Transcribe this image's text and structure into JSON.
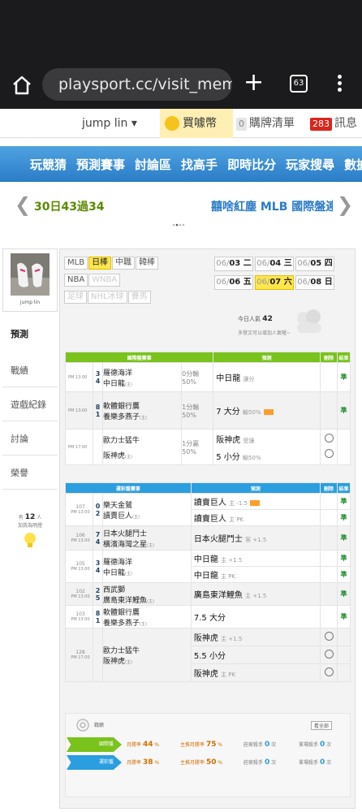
{
  "browser": {
    "url": "playsport.cc/visit_memb",
    "tab_count": "63"
  },
  "userbar": {
    "username": "jump lin ▾",
    "buy_coins": "買噱幣",
    "cart_count": "0",
    "cart_label": "購牌清單",
    "msg_count": "283",
    "msg_label": "訊息"
  },
  "main_nav": [
    "玩競猜",
    "預測賽事",
    "討論區",
    "找高手",
    "即時比分",
    "玩家搜尋",
    "數據"
  ],
  "ticker": {
    "left_text": "30日43過34",
    "right_text": "囍啥紅塵 MLB 國際盤連"
  },
  "sidebar": {
    "avatar_name": "jump lin",
    "items": [
      "預測",
      "戰績",
      "遊戲紀錄",
      "討論",
      "榮譽"
    ],
    "fav_prefix": "有",
    "fav_count": "12",
    "fav_suffix": "人",
    "fav_sub": "加我為明燈"
  },
  "leagues": {
    "row1": [
      "MLB",
      "日棒",
      "中職",
      "韓棒"
    ],
    "row2": [
      "NBA",
      "WNBA"
    ],
    "row3": [
      "足球",
      "NHL冰球",
      "賽馬"
    ]
  },
  "dates": [
    {
      "d": "06/",
      "b": "03 二"
    },
    {
      "d": "06/",
      "b": "04 三"
    },
    {
      "d": "06/",
      "b": "05 四"
    },
    {
      "d": "06/",
      "b": "06 五"
    },
    {
      "d": "06/",
      "b": "07 六"
    },
    {
      "d": "06/",
      "b": "08 日"
    }
  ],
  "popularity": {
    "label": "今日人氣",
    "value": "42",
    "sub": "多發文可以增加人氣喔~"
  },
  "intl_table": {
    "headers": [
      "國際盤賽事",
      "預測",
      "刪除",
      "結果"
    ],
    "games": [
      {
        "time": "PM 13:00",
        "n1": "3",
        "t1": "羅德海洋",
        "n2": "4",
        "t2": "中日龍",
        "t2s": "(主)",
        "odds1": "0分輸",
        "odds2": "50%",
        "pick": "中日龍",
        "pick_s": "讓分",
        "result": "準"
      },
      {
        "time": "PM 13:00",
        "n1": "8",
        "t1": "軟體銀行鷹",
        "n2": "1",
        "t2": "養樂多燕子",
        "t2s": "(主)",
        "odds1": "1分輸",
        "odds2": "50%",
        "pick": "7 大分",
        "pick_s": "輸50%",
        "result": "準"
      },
      {
        "time": "PM 17:00",
        "n1": "",
        "t1": "歐力士猛牛",
        "n2": "",
        "t2": "阪神虎",
        "t2s": "(主)",
        "odds1": "1分贏",
        "odds2": "50%",
        "pick": "阪神虎",
        "pick_s": "受讓",
        "pick2": "5 小分",
        "pick2_s": "輸50%"
      }
    ]
  },
  "tw_table": {
    "headers": [
      "運彩盤賽事",
      "預測",
      "刪除",
      "結果"
    ],
    "games": [
      {
        "code": "107",
        "time": "PM 13:00",
        "n1": "0",
        "t1": "樂天金鷲",
        "n2": "2",
        "t2": "讀賣巨人",
        "t2s": "(主)",
        "picks": [
          {
            "p": "讀賣巨人",
            "s": "主 -1.5",
            "r": "準",
            "vip": true
          },
          {
            "p": "讀賣巨人",
            "s": "主 PK",
            "r": "準"
          }
        ]
      },
      {
        "code": "106",
        "time": "PM 13:00",
        "n1": "7",
        "t1": "日本火腿鬥士",
        "n2": "4",
        "t2": "橫濱海灣之星",
        "t2s": "(主)",
        "picks": [
          {
            "p": "日本火腿鬥士",
            "s": "客 +1.5",
            "r": "準"
          }
        ]
      },
      {
        "code": "105",
        "time": "PM 13:00",
        "n1": "3",
        "t1": "羅德海洋",
        "n2": "4",
        "t2": "中日龍",
        "t2s": "(主)",
        "picks": [
          {
            "p": "中日龍",
            "s": "主 +1.5",
            "r": "準"
          },
          {
            "p": "中日龍",
            "s": "主 PK",
            "r": "準"
          }
        ]
      },
      {
        "code": "102",
        "time": "PM 13:00",
        "n1": "2",
        "t1": "西武獅",
        "n2": "5",
        "t2": "廣島東洋鯉魚",
        "t2s": "(主)",
        "picks": [
          {
            "p": "廣島東洋鯉魚",
            "s": "主 +1.5",
            "r": "準"
          }
        ]
      },
      {
        "code": "103",
        "time": "PM 13:00",
        "n1": "8",
        "t1": "軟體銀行鷹",
        "n2": "1",
        "t2": "養樂多燕子",
        "t2s": "(主)",
        "picks": [
          {
            "p": "7.5 大分",
            "s": "",
            "r": "準"
          }
        ]
      },
      {
        "code": "128",
        "time": "PM 17:00",
        "n1": "",
        "t1": "歐力士猛牛",
        "n2": "",
        "t2": "阪神虎",
        "t2s": "(主)",
        "picks": [
          {
            "p": "阪神虎",
            "s": "主 +1.5"
          },
          {
            "p": "5.5 小分",
            "s": ""
          },
          {
            "p": "阪神虎",
            "s": "主 PK"
          }
        ]
      }
    ]
  },
  "stats": {
    "label": "戰績",
    "button": "看全部",
    "rows": [
      {
        "tag": "國際盤",
        "m_label": "月勝率",
        "m_val": "44",
        "s_label": "主推月勝率",
        "s_val": "75",
        "w_label": "莊家殺手",
        "w_val": "0",
        "w_unit": "次",
        "l_label": "單場殺手",
        "l_val": "0",
        "l_unit": "次"
      },
      {
        "tag": "運彩盤",
        "m_label": "月勝率",
        "m_val": "38",
        "s_label": "主推月勝率",
        "s_val": "50",
        "w_label": "莊家殺手",
        "w_val": "0",
        "w_unit": "次",
        "l_label": "單場殺手",
        "l_val": "0",
        "l_unit": "次"
      }
    ]
  },
  "colors": {
    "intl_header": "#7ac21c",
    "tw_header": "#2b9ee0",
    "nav_blue": "#2a7cc7",
    "highlight_yellow": "#ffe64d"
  }
}
